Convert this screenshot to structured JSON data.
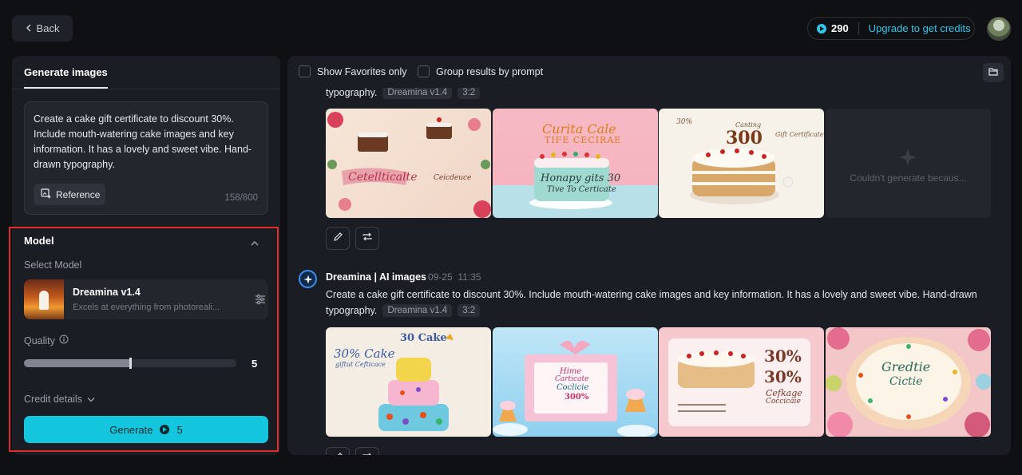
{
  "topbar": {
    "back_label": "Back",
    "credits": "290",
    "upgrade_label": "Upgrade to get credits",
    "accent_color": "#2fc6e8"
  },
  "left_panel": {
    "tab_label": "Generate images",
    "prompt_text": "Create a cake gift certificate to discount 30%. Include mouth-watering cake images and key information. It has a lovely and sweet vibe. Hand-drawn typography.",
    "reference_label": "Reference",
    "char_count": "158/800",
    "model_section_title": "Model",
    "select_model_label": "Select Model",
    "model_name": "Dreamina v1.4",
    "model_desc": "Excels at everything from photoreali...",
    "quality_label": "Quality",
    "quality_value": "5",
    "quality_fraction": 0.5,
    "credit_details_label": "Credit details",
    "generate_label": "Generate",
    "generate_cost": "5",
    "generate_color": "#13c6dd"
  },
  "right_panel": {
    "show_favorites_label": "Show Favorites only",
    "group_by_prompt_label": "Group results by prompt",
    "group1": {
      "prompt_tail": "typography.",
      "model_tag": "Dreamina v1.4",
      "ratio_tag": "3:2",
      "failed_text": "Couldn't generate becaus..."
    },
    "group2": {
      "author": "Dreamina | AI images",
      "date": "09-25",
      "time": "11:35",
      "prompt_line1": "Create a cake gift certificate to discount 30%. Include mouth-watering cake images and key information. It has a lovely and sweet vibe. Hand-drawn",
      "prompt_line2": "typography.",
      "model_tag": "Dreamina v1.4",
      "ratio_tag": "3:2"
    },
    "tile_texts": {
      "g1t2_line1": "Curita Cale",
      "g1t2_line2": "TIFE CECIRAE",
      "g1t2_line3": "Honapy gits 30",
      "g1t2_line4": "Tive To Certicate",
      "g1t3_line1": "300",
      "g1t3_line2": "Canting",
      "g1t3_line3": "Gift Certificate",
      "g1t1_line1": "Cetellticalte",
      "g1t1_line2": "Ceicdeuce",
      "g2t1_line1": "30% Cake",
      "g2t1_line2": "giftut Cefticace",
      "g2t1_line3": "30 Cake",
      "g2t2_line1": "Hime",
      "g2t2_line2": "Carticate",
      "g2t2_line3": "Coclicie",
      "g2t2_line4": "300%",
      "g2t3_line1": "30%",
      "g2t3_line2": "30%",
      "g2t3_line3": "Cefkage",
      "g2t3_line4": "Coccicaie",
      "g2t4_line1": "Gredtie",
      "g2t4_line2": "Cictie"
    }
  }
}
